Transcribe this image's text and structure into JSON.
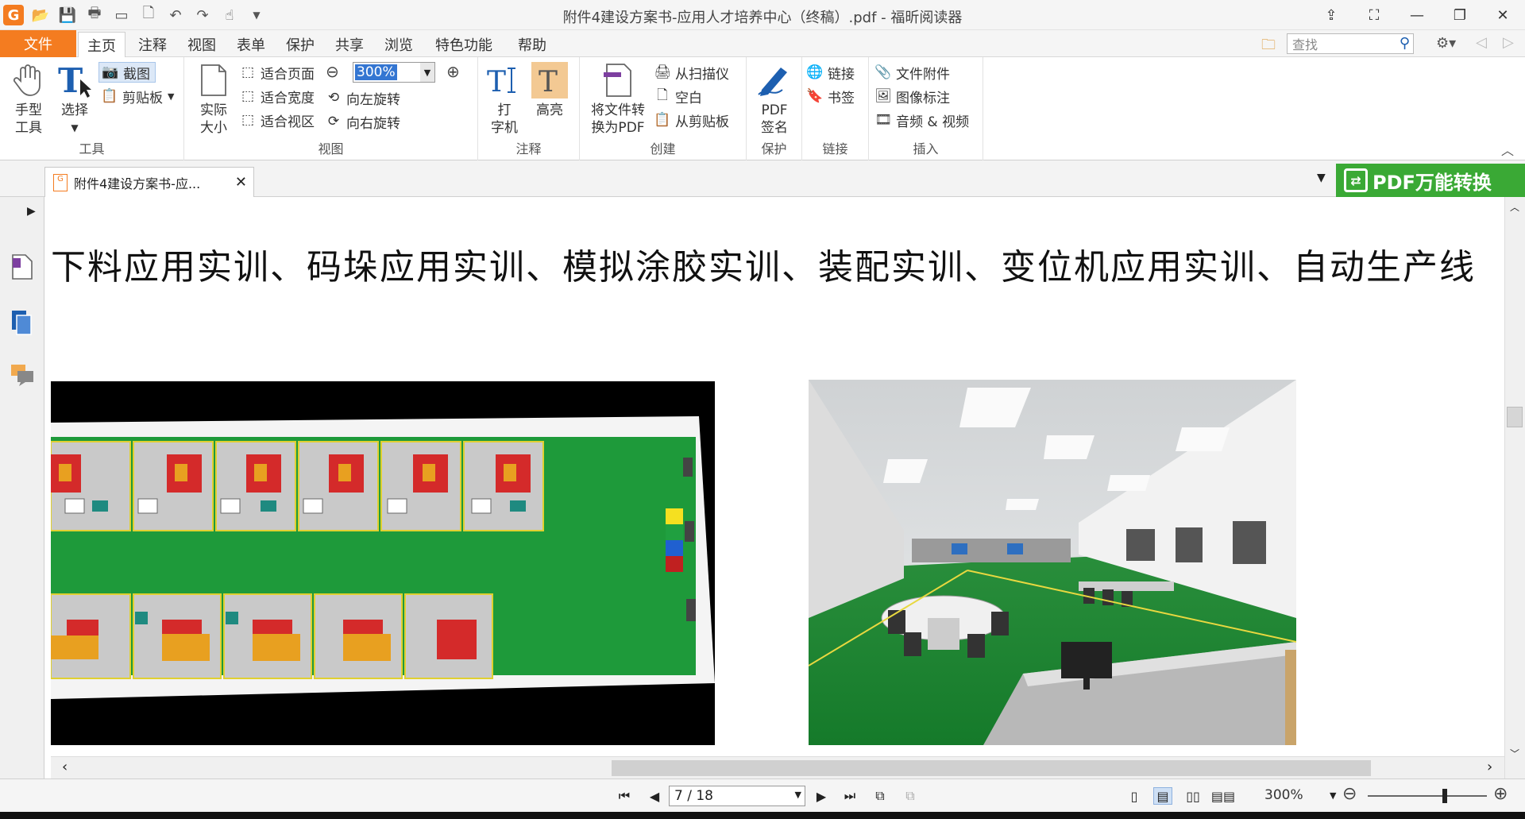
{
  "window": {
    "title": "附件4建设方案书-应用人才培养中心（终稿）.pdf - 福昕阅读器"
  },
  "menu": {
    "file": "文件",
    "tabs": [
      "主页",
      "注释",
      "视图",
      "表单",
      "保护",
      "共享",
      "浏览",
      "特色功能",
      "帮助"
    ],
    "active_tab": "主页",
    "search_placeholder": "查找"
  },
  "ribbon": {
    "tools": {
      "label": "工具",
      "hand": "手型\n工具",
      "select": "选择",
      "screenshot": "截图",
      "clipboard": "剪贴板"
    },
    "view": {
      "label": "视图",
      "actual_size": "实际\n大小",
      "fit_page": "适合页面",
      "fit_width": "适合宽度",
      "fit_visible": "适合视区",
      "zoom_value": "300%",
      "rotate_left": "向左旋转",
      "rotate_right": "向右旋转"
    },
    "comment": {
      "label": "注释",
      "typewriter": "打\n字机",
      "highlight": "高亮"
    },
    "create": {
      "label": "创建",
      "convert": "将文件转\n换为PDF",
      "from_scanner": "从扫描仪",
      "blank": "空白",
      "from_clipboard": "从剪贴板"
    },
    "protect": {
      "label": "保护",
      "pdf_sign": "PDF\n签名"
    },
    "link": {
      "label": "链接",
      "link": "链接",
      "bookmark": "书签"
    },
    "insert": {
      "label": "插入",
      "attachment": "文件附件",
      "image_annotation": "图像标注",
      "audio_video": "音频 & 视频"
    }
  },
  "doc_tab": {
    "title": "附件4建设方案书-应..."
  },
  "banner": {
    "text": "PDF万能转换"
  },
  "document": {
    "line": "下料应用实训、码垛应用实训、模拟涂胶实训、装配实训、变位机应用实训、自动生产线"
  },
  "status": {
    "page": "7 / 18",
    "zoom": "300%"
  },
  "colors": {
    "accent": "#f47c20",
    "banner_green": "#3aa935",
    "floor_green": "#1e9a3a"
  }
}
